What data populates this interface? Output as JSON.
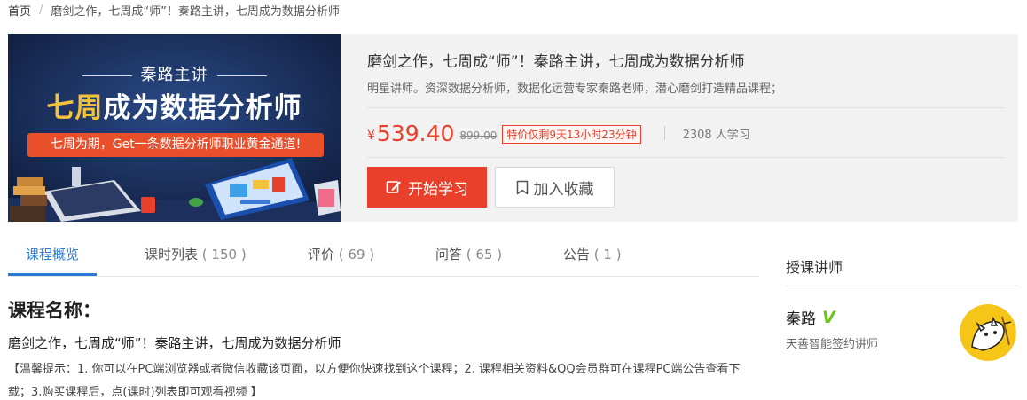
{
  "breadcrumb": {
    "home": "首页",
    "separator": "/",
    "current": "磨剑之作，七周成“师”！秦路主讲，七周成为数据分析师"
  },
  "cover": {
    "caption_top": "秦路主讲",
    "caption_main_highlight": "七周",
    "caption_main_rest": "成为数据分析师",
    "caption_banner": "七周为期，Get一条数据分析师职业黄金通道!"
  },
  "course": {
    "title": "磨剑之作，七周成“师”！秦路主讲，七周成为数据分析师",
    "description": "明星讲师。资深数据分析师，数据化运营专家秦路老师，潜心磨剑打造精品课程；",
    "currency": "¥",
    "price": "539.40",
    "original_price": "899.00",
    "promo": "特价仅剩9天13小时23分钟",
    "learners": "2308 人学习",
    "start_label": "开始学习",
    "favorite_label": "加入收藏"
  },
  "tabs": [
    {
      "label": "课程概览",
      "count": ""
    },
    {
      "label": "课时列表",
      "count": "( 150 )"
    },
    {
      "label": "评价",
      "count": "( 69 )"
    },
    {
      "label": "问答",
      "count": "( 65 )"
    },
    {
      "label": "公告",
      "count": "( 1 )"
    }
  ],
  "overview": {
    "section_title": "课程名称：",
    "course_name": "磨剑之作，七周成“师”！秦路主讲，七周成为数据分析师",
    "tip": "【温馨提示：1. 你可以在PC端浏览器或者微信收藏该页面，以方便你快速找到这个课程；2. 课程相关资料&QQ会员群可在课程PC端公告查看下载；3.购买课程后，点(课时)列表即可观看视频 】"
  },
  "teacher": {
    "heading": "授课讲师",
    "name": "秦路",
    "verified_mark": "V",
    "title": "天善智能签约讲师"
  },
  "colors": {
    "accent_red": "#e8402a",
    "accent_blue": "#2a7bd6",
    "verified_green": "#6cc51b"
  },
  "icons": {
    "start": "edit-icon",
    "favorite": "bookmark-icon",
    "verified": "verified-v-icon"
  }
}
